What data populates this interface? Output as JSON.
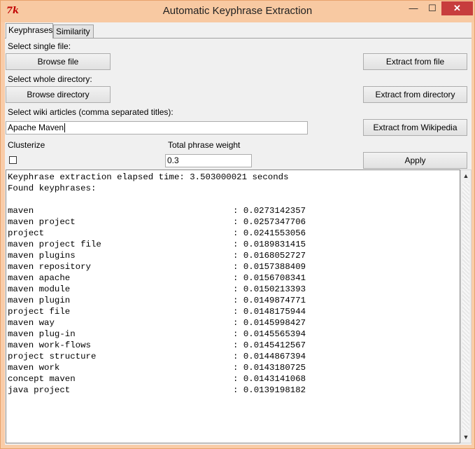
{
  "window": {
    "title": "Automatic Keyphrase Extraction",
    "icon_name": "tk-feather-icon",
    "minimize_glyph": "—",
    "maximize_glyph": "☐",
    "close_glyph": "✕"
  },
  "tabs": [
    {
      "label": "Keyphrases",
      "active": true
    },
    {
      "label": "Similarity",
      "active": false
    }
  ],
  "single_file": {
    "label": "Select single file:",
    "browse_label": "Browse file",
    "extract_label": "Extract from file"
  },
  "directory": {
    "label": "Select whole directory:",
    "browse_label": "Browse directory",
    "extract_label": "Extract from directory"
  },
  "wiki": {
    "label": "Select wiki articles (comma separated titles):",
    "input_value": "Apache Maven",
    "extract_label": "Extract from Wikipedia"
  },
  "options": {
    "clusterize_label": "Clusterize",
    "clusterize_checked": false,
    "weight_label": "Total phrase weight",
    "weight_value": "0.3",
    "apply_label": "Apply"
  },
  "output": {
    "elapsed_line": "Keyphrase extraction elapsed time: 3.503000021 seconds",
    "found_line": "Found keyphrases:",
    "separator": ": ",
    "keyphrases": [
      {
        "phrase": "maven",
        "score": "0.0273142357"
      },
      {
        "phrase": "maven project",
        "score": "0.0257347706"
      },
      {
        "phrase": "project",
        "score": "0.0241553056"
      },
      {
        "phrase": "maven project file",
        "score": "0.0189831415"
      },
      {
        "phrase": "maven plugins",
        "score": "0.0168052727"
      },
      {
        "phrase": "maven repository",
        "score": "0.0157388409"
      },
      {
        "phrase": "maven apache",
        "score": "0.0156708341"
      },
      {
        "phrase": "maven module",
        "score": "0.0150213393"
      },
      {
        "phrase": "maven plugin",
        "score": "0.0149874771"
      },
      {
        "phrase": "project file",
        "score": "0.0148175944"
      },
      {
        "phrase": "maven way",
        "score": "0.0145998427"
      },
      {
        "phrase": "maven plug-in",
        "score": "0.0145565394"
      },
      {
        "phrase": "maven work-flows",
        "score": "0.0145412567"
      },
      {
        "phrase": "project structure",
        "score": "0.0144867394"
      },
      {
        "phrase": "maven work",
        "score": "0.0143180725"
      },
      {
        "phrase": "concept maven",
        "score": "0.0143141068"
      },
      {
        "phrase": "java project",
        "score": "0.0139198182"
      }
    ]
  },
  "scrollbar": {
    "up_glyph": "▲",
    "down_glyph": "▼"
  }
}
